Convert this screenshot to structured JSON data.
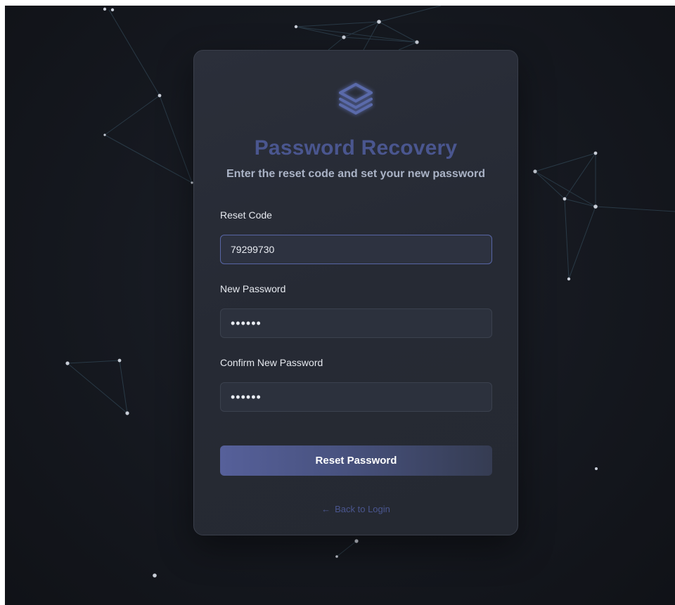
{
  "card": {
    "title": "Password Recovery",
    "subtitle": "Enter the reset code and set your new password"
  },
  "form": {
    "reset_code_label": "Reset Code",
    "reset_code_value": "79299730",
    "new_password_label": "New Password",
    "new_password_value": "••••••",
    "confirm_password_label": "Confirm New Password",
    "confirm_password_value": "••••••",
    "submit_label": "Reset Password",
    "back_arrow": "←",
    "back_label": "Back to Login"
  },
  "icons": {
    "logo": "layers-icon"
  },
  "colors": {
    "accent": "#4a568f",
    "button_start": "#56609a",
    "card_bg": "#2b2f3a",
    "page_bg": "#15181f"
  }
}
